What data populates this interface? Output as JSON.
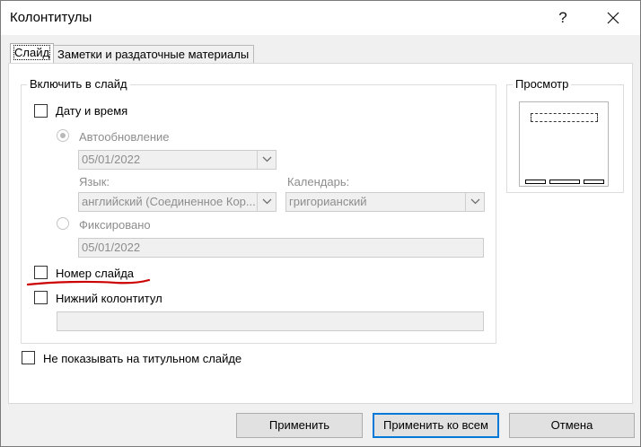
{
  "window": {
    "title": "Колонтитулы",
    "help_label": "?"
  },
  "tabs": [
    {
      "label": "Слайд",
      "active": true
    },
    {
      "label": "Заметки и раздаточные материалы",
      "active": false
    }
  ],
  "include_group": {
    "label": "Включить в слайд",
    "date_time": {
      "label": "Дату и время",
      "checked": false
    },
    "auto_update": {
      "label": "Автообновление",
      "selected": true,
      "enabled": false,
      "date_value": "05/01/2022"
    },
    "language": {
      "label": "Язык:",
      "value": "английский (Соединенное Кор..."
    },
    "calendar": {
      "label": "Календарь:",
      "value": "григорианский"
    },
    "fixed": {
      "label": "Фиксировано",
      "selected": false,
      "value": "05/01/2022"
    },
    "slide_number": {
      "label": "Номер слайда",
      "checked": false
    },
    "footer": {
      "label": "Нижний колонтитул",
      "checked": false,
      "value": ""
    }
  },
  "dont_show_title": {
    "label": "Не показывать на титульном слайде",
    "checked": false
  },
  "preview": {
    "label": "Просмотр"
  },
  "buttons": {
    "apply": "Применить",
    "apply_all": "Применить ко всем",
    "cancel": "Отмена"
  },
  "colors": {
    "annotation_underline": "#cc0000",
    "default_button_border": "#0078d7"
  },
  "icons": {
    "close": "close-icon",
    "dropdown": "chevron-down-icon"
  }
}
